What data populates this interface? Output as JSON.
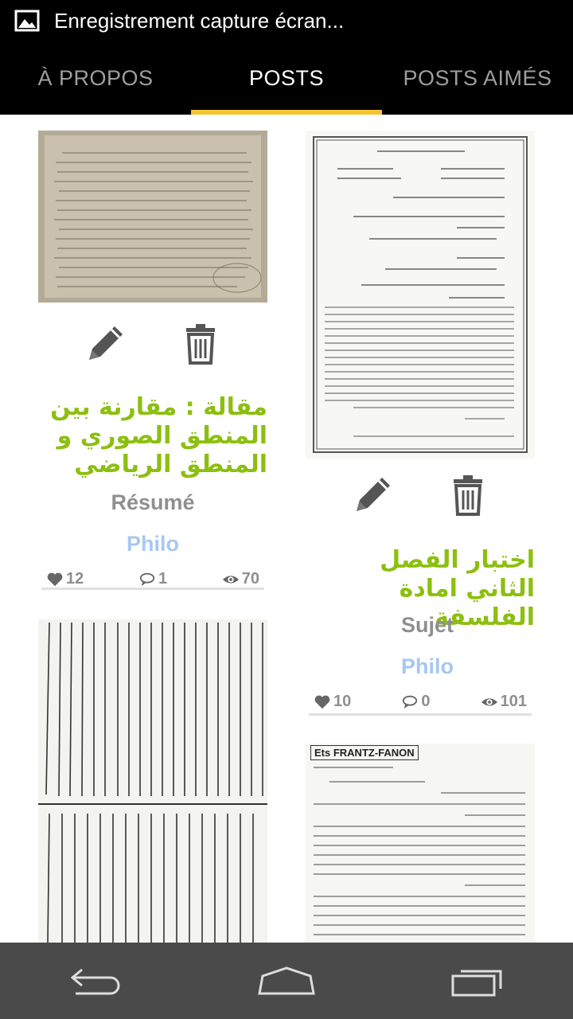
{
  "statusbar": {
    "notification_text": "Enregistrement capture écran..."
  },
  "tabs": [
    {
      "label": "À PROPOS",
      "active": false
    },
    {
      "label": "POSTS",
      "active": true
    },
    {
      "label": "POSTS AIMÉS",
      "active": false
    }
  ],
  "posts": [
    {
      "title": "مقالة : مقارنة بين المنطق الصوري و المنطق الرياضي",
      "type": "Résumé",
      "category": "Philo",
      "likes": "12",
      "comments": "1",
      "views": "70",
      "edit_icon": "pencil-icon",
      "delete_icon": "trash-icon"
    },
    {
      "title": "اختبار الفصل الثاني امادة الفلسفة",
      "type": "Sujet",
      "category": "Philo",
      "likes": "10",
      "comments": "0",
      "views": "101",
      "edit_icon": "pencil-icon",
      "delete_icon": "trash-icon"
    },
    {
      "thumbnail": "handwritten-arabic-document"
    },
    {
      "thumbnail": "printed-document",
      "header_text": "Ets FRANTZ-FANON"
    }
  ],
  "navbar": {
    "back_icon": "back-icon",
    "home_icon": "home-icon",
    "recents_icon": "recents-icon"
  },
  "colors": {
    "accent": "#f4c430",
    "title_green": "#8cbf0f",
    "category_blue": "#a7c7f2",
    "gray_text": "#8f8f8f"
  }
}
